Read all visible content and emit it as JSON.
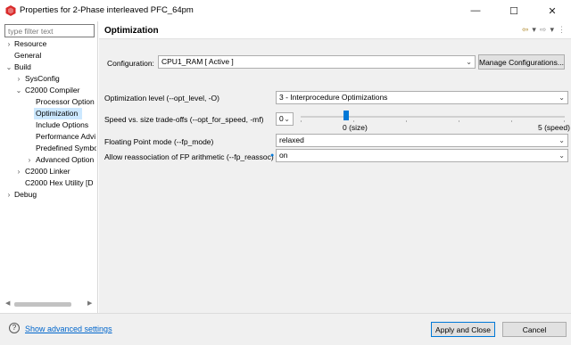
{
  "window": {
    "title": "Properties for 2-Phase interleaved PFC_64pm",
    "minimize": "—",
    "maximize": "☐",
    "close": "✕"
  },
  "sidebar": {
    "filter_placeholder": "type filter text",
    "items": [
      {
        "label": "Resource",
        "twisty": "›"
      },
      {
        "label": "General",
        "twisty": ""
      },
      {
        "label": "Build",
        "twisty": "⌄"
      },
      {
        "label": "SysConfig",
        "twisty": "›"
      },
      {
        "label": "C2000 Compiler",
        "twisty": "⌄"
      },
      {
        "label": "Processor Option",
        "twisty": ""
      },
      {
        "label": "Optimization",
        "twisty": ""
      },
      {
        "label": "Include Options",
        "twisty": ""
      },
      {
        "label": "Performance Advi",
        "twisty": ""
      },
      {
        "label": "Predefined Symbo",
        "twisty": ""
      },
      {
        "label": "Advanced Option",
        "twisty": "›"
      },
      {
        "label": "C2000 Linker",
        "twisty": "›"
      },
      {
        "label": "C2000 Hex Utility  [D",
        "twisty": ""
      },
      {
        "label": "Debug",
        "twisty": "›"
      }
    ]
  },
  "page": {
    "title": "Optimization",
    "configuration_label": "Configuration:",
    "configuration_value": "CPU1_RAM  [ Active ]",
    "manage_configurations": "Manage Configurations...",
    "opt_level_label": "Optimization level (--opt_level, -O)",
    "opt_level_value": "3 - Interprocedure Optimizations",
    "speed_label": "Speed vs. size trade-offs (--opt_for_speed, -mf)",
    "speed_value": "0",
    "speed_min_label": "0 (size)",
    "speed_max_label": "5 (speed)",
    "speed_level": 0,
    "fp_mode_label": "Floating Point mode (--fp_mode)",
    "fp_mode_value": "relaxed",
    "fp_reassoc_label": "Allow reassociation of FP arithmetic (--fp_reassoc)",
    "fp_reassoc_value": "on"
  },
  "footer": {
    "show_advanced": "Show advanced settings",
    "apply_and_close": "Apply and Close",
    "cancel": "Cancel"
  },
  "colors": {
    "accent": "#0078d7",
    "selection": "#cce8ff",
    "link": "#0066cc",
    "app_icon": "#d92b2b"
  }
}
